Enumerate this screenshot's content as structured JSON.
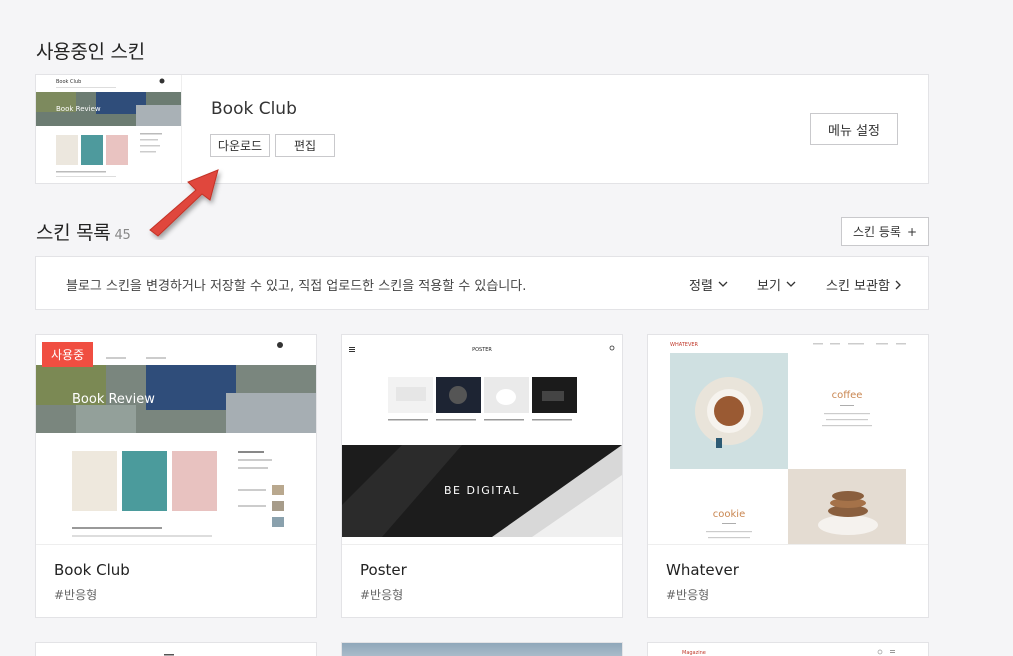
{
  "used_section": {
    "title": "사용중인 스킨"
  },
  "current_skin": {
    "name": "Book Club",
    "download_label": "다운로드",
    "edit_label": "편집",
    "menu_settings_label": "메뉴 설정",
    "thumb_logo": "Book Club",
    "thumb_banner": "Book Review"
  },
  "list_section": {
    "title": "스킨 목록",
    "count": "45"
  },
  "register_button": {
    "label": "스킨 등록",
    "icon": "plus-icon"
  },
  "info_bar": {
    "description": "블로그 스킨을 변경하거나 저장할 수 있고, 직접 업로드한 스킨을 적용할 수 있습니다.",
    "sort_label": "정렬",
    "view_label": "보기",
    "storage_label": "스킨 보관함"
  },
  "cards": [
    {
      "name": "Book Club",
      "tag": "#반응형",
      "badge": "사용중",
      "banner": "Book Review"
    },
    {
      "name": "Poster",
      "tag": "#반응형",
      "logo": "POSTER",
      "banner": "BE DIGITAL"
    },
    {
      "name": "Whatever",
      "tag": "#반응형",
      "logo": "WHATEVER",
      "word1": "coffee",
      "word2": "cookie"
    }
  ],
  "bottom_cards": [
    {
      "logo": ""
    },
    {
      "logo": ""
    },
    {
      "logo": "Magazine"
    }
  ],
  "colors": {
    "accent": "#f04e41",
    "border": "#e3e3e6",
    "background": "#f5f5f7"
  }
}
